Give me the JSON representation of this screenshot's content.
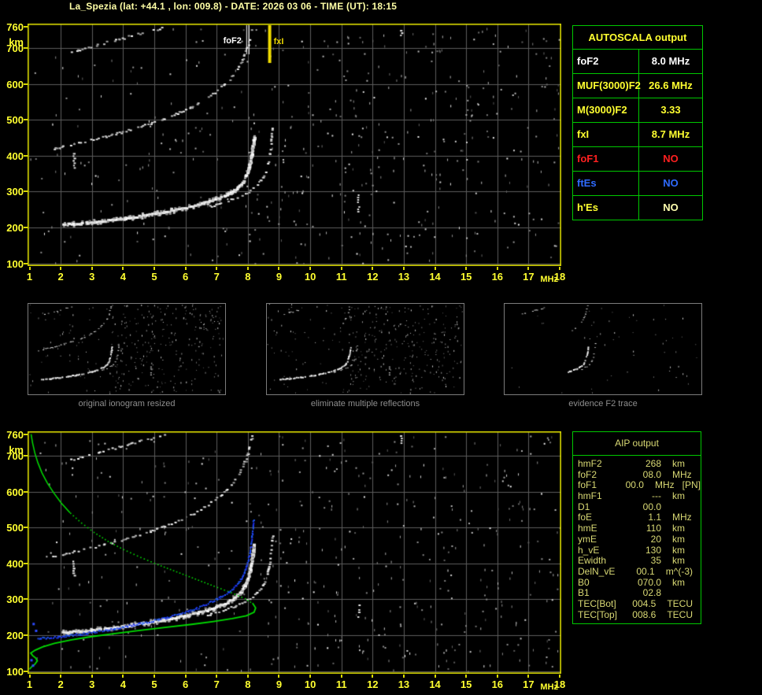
{
  "title": "La_Spezia (lat: +44.1 , lon: 009.8) - DATE: 2026 03 06 - TIME (UT): 18:15",
  "colors": {
    "accent_yellow": "#ffff30",
    "pale_yellow": "#ffffa6",
    "table_green": "#00c800",
    "khaki_text": "#d9d974",
    "grid_gray": "#5c5c5c",
    "plot_border_yellow": "#d8d800",
    "profile_green": "#00dc00",
    "restored_trace_blue": "#2d4bff",
    "fof1_red": "#ff2020",
    "ftes_blue": "#2f6bff"
  },
  "axes": {
    "x_unit": "MHz",
    "y_unit": "km",
    "x_ticks": [
      1,
      2,
      3,
      4,
      5,
      6,
      7,
      8,
      9,
      10,
      11,
      12,
      13,
      14,
      15,
      16,
      17,
      18
    ],
    "y_ticks": [
      760,
      700,
      600,
      500,
      400,
      300,
      200,
      100
    ]
  },
  "markers": {
    "fof2_label": "foF2",
    "fof2_mhz": 8.0,
    "fxi_label": "fxI",
    "fxi_mhz": 8.7
  },
  "autoscala": {
    "header": "AUTOSCALA output",
    "rows": [
      {
        "label": "foF2",
        "value": "8.0 MHz",
        "color": "#ffffff"
      },
      {
        "label": "MUF(3000)F2",
        "value": "26.6 MHz",
        "color": "#ffff30"
      },
      {
        "label": "M(3000)F2",
        "value": "3.33",
        "color": "#ffff30"
      },
      {
        "label": "fxI",
        "value": "8.7 MHz",
        "color": "#ffff30"
      },
      {
        "label": "foF1",
        "value": "NO",
        "color": "#ff2020"
      },
      {
        "label": "ftEs",
        "value": "NO",
        "color": "#2f6bff"
      },
      {
        "label": "h'Es",
        "value": "NO",
        "color": "#ffff30",
        "value_color": "#ffffb0"
      }
    ]
  },
  "aip": {
    "header": "AIP output",
    "rows": [
      {
        "param": "hmF2",
        "value": "268",
        "unit": "km"
      },
      {
        "param": "foF2",
        "value": "08.0",
        "unit": "MHz"
      },
      {
        "param": "foF1",
        "value": "00.0",
        "unit": "MHz",
        "note": "[PN]"
      },
      {
        "param": "hmF1",
        "value": "---",
        "unit": "km"
      },
      {
        "param": "D1",
        "value": "00.0",
        "unit": ""
      },
      {
        "param": "foE",
        "value": "1.1",
        "unit": "MHz"
      },
      {
        "param": "hmE",
        "value": "110",
        "unit": "km"
      },
      {
        "param": "ymE",
        "value": "20",
        "unit": "km"
      },
      {
        "param": "h_vE",
        "value": "130",
        "unit": "km"
      },
      {
        "param": "Ewidth",
        "value": "35",
        "unit": "km"
      },
      {
        "param": "DelN_vE",
        "value": "00.1",
        "unit": "m^(-3)"
      },
      {
        "param": "B0",
        "value": "070.0",
        "unit": "km"
      },
      {
        "param": "B1",
        "value": "02.8",
        "unit": ""
      },
      {
        "param": "TEC[Bot]",
        "value": "004.5",
        "unit": "TECU"
      },
      {
        "param": "TEC[Top]",
        "value": "008.6",
        "unit": "TECU"
      }
    ]
  },
  "thumbnails": [
    {
      "caption": "original ionogram resized",
      "noise": "normal",
      "shows": [
        {
          "id": "F2_1st_hop_o"
        },
        {
          "id": "F2_1st_hop_x"
        },
        {
          "id": "second_hop"
        },
        {
          "id": "third_hop"
        }
      ]
    },
    {
      "caption": "eliminate multiple reflections",
      "noise": "normal",
      "shows": [
        {
          "id": "F2_1st_hop_o"
        },
        {
          "id": "F2_1st_hop_x"
        },
        {
          "id": "third_hop",
          "f_max": 4.3
        },
        {
          "id": "second_hop",
          "f_min": 7.2
        }
      ]
    },
    {
      "caption": "evidence F2 trace",
      "noise": "sparse",
      "shows": [
        {
          "id": "F2_1st_hop_o",
          "f_min": 6.2
        },
        {
          "id": "F2_1st_hop_x",
          "f_min": 7.4
        },
        {
          "id": "second_hop",
          "f_min": 6.8
        },
        {
          "id": "third_hop",
          "f_max": 4.7
        }
      ]
    }
  ],
  "chart_data": [
    {
      "id": "main_ionogram",
      "type": "scatter",
      "title": "Ionogram with AUTOSCALA frequency markers",
      "xlabel": "MHz",
      "ylabel": "km",
      "xlim": [
        1,
        18
      ],
      "ylim": [
        100,
        760
      ],
      "grid": true,
      "markers": [
        {
          "name": "foF2",
          "x": 8.0,
          "color": "#ffffff"
        },
        {
          "name": "fxI",
          "x": 8.7,
          "color": "#e8d400"
        }
      ],
      "series": [
        {
          "id": "F2_1st_hop_o",
          "name": "F2 trace, 1st hop (o-mode)",
          "color": "#ffffff",
          "points": [
            [
              2.05,
              211
            ],
            [
              2.35,
              212
            ],
            [
              2.7,
              214
            ],
            [
              3.0,
              217
            ],
            [
              3.3,
              220
            ],
            [
              3.6,
              223
            ],
            [
              3.9,
              226
            ],
            [
              4.2,
              230
            ],
            [
              4.5,
              234
            ],
            [
              4.8,
              238
            ],
            [
              5.1,
              242
            ],
            [
              5.4,
              247
            ],
            [
              5.7,
              252
            ],
            [
              6.0,
              258
            ],
            [
              6.3,
              264
            ],
            [
              6.6,
              271
            ],
            [
              6.9,
              279
            ],
            [
              7.15,
              288
            ],
            [
              7.4,
              298
            ],
            [
              7.6,
              310
            ],
            [
              7.75,
              323
            ],
            [
              7.88,
              340
            ],
            [
              7.97,
              360
            ],
            [
              8.04,
              385
            ],
            [
              8.1,
              412
            ],
            [
              8.14,
              438
            ],
            [
              8.17,
              458
            ]
          ]
        },
        {
          "id": "F2_1st_hop_x",
          "name": "F2 trace, 1st hop (x-mode)",
          "color": "#dddddd",
          "points": [
            [
              6.7,
              259
            ],
            [
              7.0,
              266
            ],
            [
              7.3,
              274
            ],
            [
              7.6,
              284
            ],
            [
              7.9,
              296
            ],
            [
              8.15,
              310
            ],
            [
              8.35,
              327
            ],
            [
              8.5,
              347
            ],
            [
              8.6,
              372
            ],
            [
              8.67,
              400
            ],
            [
              8.72,
              432
            ],
            [
              8.75,
              462
            ],
            [
              8.77,
              485
            ]
          ]
        },
        {
          "id": "second_hop",
          "name": "2nd hop (multiple reflection)",
          "color": "#cccccc",
          "points": [
            [
              1.75,
              420
            ],
            [
              2.05,
              427
            ],
            [
              2.4,
              434
            ],
            [
              2.75,
              441
            ],
            [
              3.1,
              448
            ],
            [
              3.45,
              456
            ],
            [
              3.8,
              464
            ],
            [
              4.15,
              472
            ],
            [
              4.5,
              481
            ],
            [
              4.85,
              491
            ],
            [
              5.2,
              501
            ],
            [
              5.55,
              513
            ],
            [
              5.9,
              526
            ],
            [
              6.2,
              539
            ],
            [
              6.5,
              554
            ],
            [
              6.8,
              571
            ],
            [
              7.1,
              590
            ],
            [
              7.35,
              611
            ],
            [
              7.57,
              634
            ],
            [
              7.75,
              660
            ],
            [
              7.9,
              688
            ],
            [
              8.0,
              716
            ],
            [
              8.07,
              742
            ],
            [
              8.12,
              760
            ]
          ]
        },
        {
          "id": "third_hop",
          "name": "3rd hop (multiple reflection)",
          "color": "#bbbbbb",
          "points": [
            [
              2.3,
              690
            ],
            [
              2.65,
              699
            ],
            [
              3.0,
              707
            ],
            [
              3.35,
              715
            ],
            [
              3.7,
              723
            ],
            [
              4.05,
              731
            ],
            [
              4.4,
              739
            ],
            [
              4.75,
              747
            ],
            [
              5.1,
              754
            ],
            [
              5.35,
              760
            ]
          ]
        }
      ],
      "noise_clusters": [
        {
          "x": 2.42,
          "y_from": 362,
          "y_to": 414
        },
        {
          "x": 11.55,
          "y_from": 242,
          "y_to": 292
        },
        {
          "x": 12.92,
          "y_from": 737,
          "y_to": 757
        }
      ]
    },
    {
      "id": "aip_ionogram",
      "type": "scatter",
      "title": "Ionogram with AIP electron density profile and restored trace",
      "xlabel": "MHz",
      "ylabel": "km",
      "xlim": [
        1,
        18
      ],
      "ylim": [
        100,
        760
      ],
      "grid": true,
      "echo_series_from": "main_ionogram",
      "series": [
        {
          "id": "profile",
          "name": "Electron density profile (plasma frequency vs height)",
          "color": "#00dc00",
          "points": [
            [
              1.05,
              760
            ],
            [
              1.1,
              735
            ],
            [
              1.17,
              708
            ],
            [
              1.27,
              680
            ],
            [
              1.4,
              652
            ],
            [
              1.57,
              624
            ],
            [
              1.78,
              596
            ],
            [
              2.02,
              568
            ],
            [
              2.3,
              541
            ],
            [
              2.65,
              514
            ],
            [
              3.05,
              488
            ],
            [
              3.5,
              463
            ],
            [
              4.0,
              440
            ],
            [
              4.55,
              418
            ],
            [
              5.1,
              398
            ],
            [
              5.7,
              378
            ],
            [
              6.3,
              358
            ],
            [
              6.9,
              338
            ],
            [
              7.45,
              320
            ],
            [
              7.9,
              303
            ],
            [
              8.15,
              289
            ],
            [
              8.25,
              276
            ],
            [
              8.2,
              264
            ],
            [
              7.95,
              254
            ],
            [
              7.5,
              246
            ],
            [
              6.9,
              238
            ],
            [
              6.2,
              230
            ],
            [
              5.4,
              222
            ],
            [
              4.6,
              214
            ],
            [
              3.8,
              205
            ],
            [
              3.0,
              196
            ],
            [
              2.35,
              187
            ],
            [
              1.8,
              177
            ],
            [
              1.42,
              167
            ],
            [
              1.18,
              158
            ],
            [
              1.04,
              150
            ],
            [
              1.1,
              143
            ],
            [
              1.2,
              136
            ],
            [
              1.25,
              128
            ],
            [
              1.17,
              119
            ],
            [
              1.07,
              112
            ],
            [
              1.0,
              105
            ]
          ]
        },
        {
          "id": "restored_trace",
          "name": "Restored/calculated F2 trace",
          "color": "#2d4bff",
          "points": [
            [
              1.25,
              194
            ],
            [
              1.45,
              194
            ],
            [
              1.62,
              195
            ],
            [
              1.8,
              196
            ],
            [
              2.0,
              198
            ],
            [
              2.25,
              201
            ],
            [
              2.55,
              204
            ],
            [
              2.9,
              208
            ],
            [
              3.25,
              213
            ],
            [
              3.6,
              218
            ],
            [
              3.95,
              224
            ],
            [
              4.3,
              230
            ],
            [
              4.65,
              236
            ],
            [
              5.0,
              243
            ],
            [
              5.35,
              250
            ],
            [
              5.7,
              258
            ],
            [
              6.05,
              267
            ],
            [
              6.4,
              278
            ],
            [
              6.7,
              290
            ],
            [
              7.0,
              303
            ],
            [
              7.3,
              318
            ],
            [
              7.55,
              335
            ],
            [
              7.75,
              356
            ],
            [
              7.9,
              382
            ],
            [
              8.0,
              412
            ],
            [
              8.07,
              444
            ],
            [
              8.12,
              478
            ],
            [
              8.15,
              508
            ],
            [
              8.17,
              528
            ]
          ]
        },
        {
          "id": "restored_isolated",
          "name": "Isolated restored-trace echoes",
          "color": "#2d4bff",
          "points": [
            [
              1.12,
              232
            ],
            [
              1.2,
              213
            ],
            [
              1.05,
              131
            ],
            [
              1.1,
              116
            ]
          ]
        }
      ]
    }
  ]
}
